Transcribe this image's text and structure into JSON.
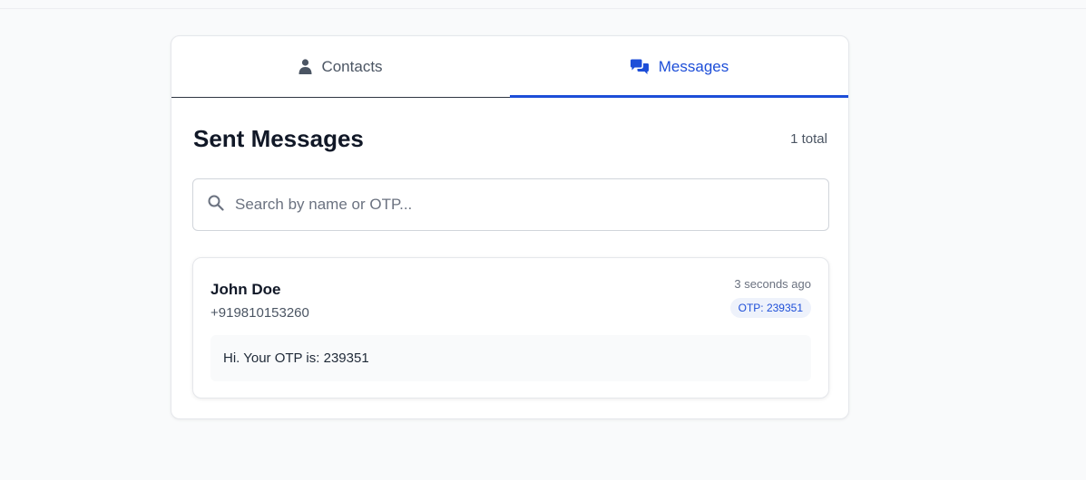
{
  "tabs": [
    {
      "label": "Contacts",
      "icon": "user-icon",
      "active": false
    },
    {
      "label": "Messages",
      "icon": "chat-bubbles-icon",
      "active": true
    }
  ],
  "header": {
    "title": "Sent Messages",
    "count": "1 total"
  },
  "search": {
    "placeholder": "Search by name or OTP...",
    "value": ""
  },
  "messages": [
    {
      "name": "John Doe",
      "phone": "+919810153260",
      "time": "3 seconds ago",
      "otp_badge": "OTP: 239351",
      "body": "Hi. Your OTP is: 239351"
    }
  ],
  "colors": {
    "accent": "#1d4ed8",
    "badge_bg": "#eef2fb",
    "page_bg": "#f9fafb"
  }
}
